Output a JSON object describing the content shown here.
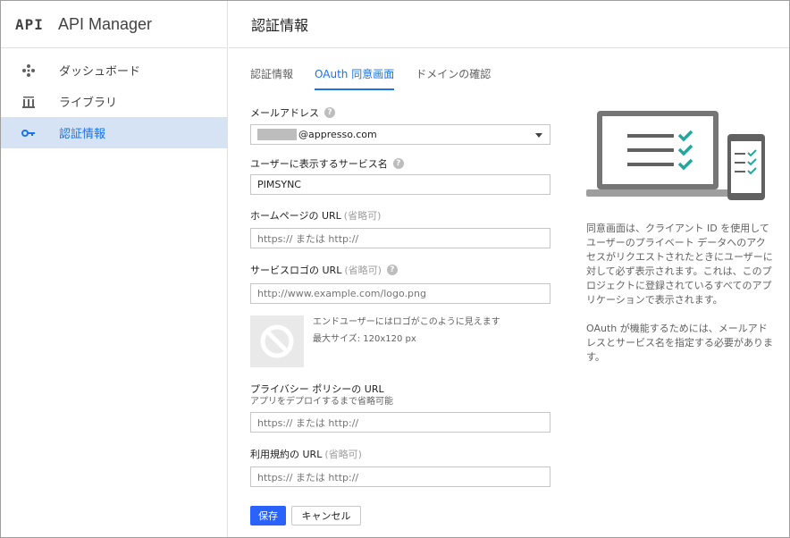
{
  "app": {
    "logo_text": "API",
    "title": "API Manager"
  },
  "sidebar": {
    "items": [
      {
        "label": "ダッシュボード",
        "icon": "dashboard-icon",
        "active": false
      },
      {
        "label": "ライブラリ",
        "icon": "library-icon",
        "active": false
      },
      {
        "label": "認証情報",
        "icon": "key-icon",
        "active": true
      }
    ]
  },
  "header": {
    "title": "認証情報"
  },
  "tabs": [
    {
      "label": "認証情報",
      "active": false
    },
    {
      "label": "OAuth 同意画面",
      "active": true
    },
    {
      "label": "ドメインの確認",
      "active": false
    }
  ],
  "form": {
    "email": {
      "label": "メールアドレス",
      "value_suffix": "@appresso.com"
    },
    "product_name": {
      "label": "ユーザーに表示するサービス名",
      "value": "PIMSYNC"
    },
    "homepage": {
      "label": "ホームページの URL",
      "optional": "(省略可)",
      "placeholder": "https:// または http://"
    },
    "logo": {
      "label": "サービスロゴの URL",
      "optional": "(省略可)",
      "placeholder": "http://www.example.com/logo.png",
      "hint": "エンドユーザーにはロゴがこのように見えます",
      "max_size": "最大サイズ: 120x120 px"
    },
    "privacy": {
      "label": "プライバシー ポリシーの URL",
      "sublabel": "アプリをデプロイするまで省略可能",
      "placeholder": "https:// または http://"
    },
    "terms": {
      "label": "利用規約の URL",
      "optional": "(省略可)",
      "placeholder": "https:// または http://"
    },
    "save_label": "保存",
    "cancel_label": "キャンセル"
  },
  "info": {
    "paragraph1": "同意画面は、クライアント ID を使用してユーザーのプライベート データへのアクセスがリクエストされたときにユーザーに対して必ず表示されます。これは、このプロジェクトに登録されているすべてのアプリケーションで表示されます。",
    "paragraph2": "OAuth が機能するためには、メールアドレスとサービス名を指定する必要があります。"
  },
  "colors": {
    "accent": "#1a73e8",
    "active_nav_bg": "#d6e3f5",
    "save_button": "#2962ff",
    "check_green": "#26a69a"
  }
}
